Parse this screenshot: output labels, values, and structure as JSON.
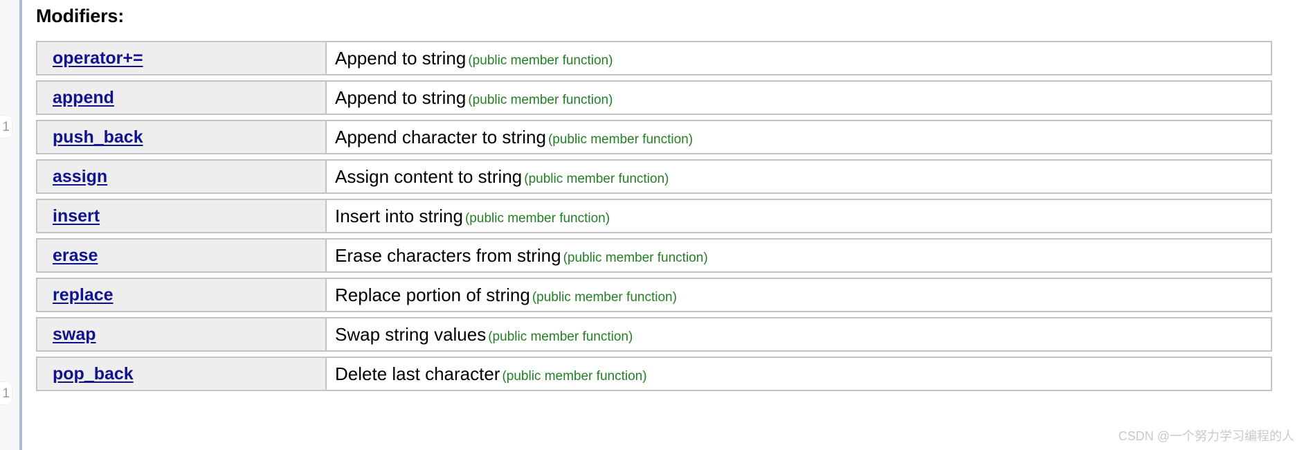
{
  "gutter": {
    "markers": [
      {
        "label": "1"
      },
      {
        "label": "1"
      }
    ]
  },
  "section": {
    "heading": "Modifiers:"
  },
  "table": {
    "rows": [
      {
        "name": "operator+=",
        "description": "Append to string",
        "kind": "(public member function)"
      },
      {
        "name": "append",
        "description": "Append to string",
        "kind": "(public member function)"
      },
      {
        "name": "push_back",
        "description": "Append character to string",
        "kind": "(public member function)"
      },
      {
        "name": "assign",
        "description": "Assign content to string",
        "kind": "(public member function)"
      },
      {
        "name": "insert",
        "description": "Insert into string",
        "kind": "(public member function)"
      },
      {
        "name": "erase",
        "description": "Erase characters from string",
        "kind": "(public member function)"
      },
      {
        "name": "replace",
        "description": "Replace portion of string",
        "kind": "(public member function)"
      },
      {
        "name": "swap",
        "description": "Swap string values",
        "kind": "(public member function)"
      },
      {
        "name": "pop_back",
        "description": "Delete last character",
        "kind": "(public member function)"
      }
    ]
  },
  "watermark": {
    "text": "CSDN @一个努力学习编程的人"
  },
  "colors": {
    "link": "#11128f",
    "kind_note": "#237f24",
    "row_name_bg": "#eeeeee",
    "border": "#c3c3c3",
    "gutter_rule": "#abbccd",
    "watermark": "#c9c9c9"
  }
}
